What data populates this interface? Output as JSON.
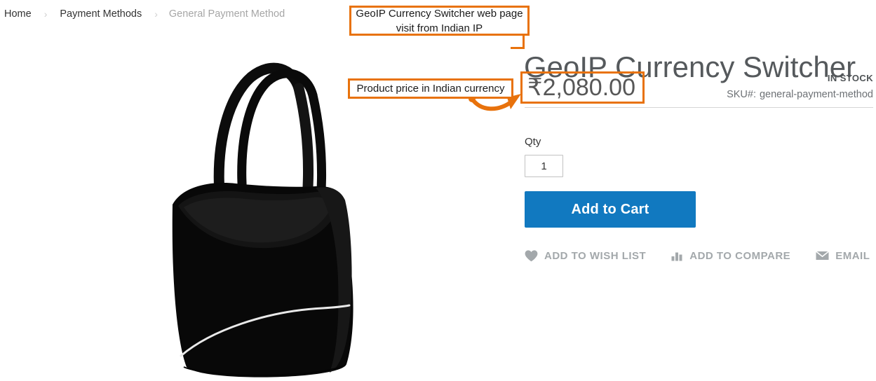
{
  "breadcrumb": {
    "separator": "›",
    "items": [
      {
        "label": "Home",
        "current": false
      },
      {
        "label": "Payment Methods",
        "current": false
      },
      {
        "label": "General Payment Method",
        "current": true
      }
    ]
  },
  "product": {
    "title": "GeoIP Currency Switcher",
    "price": "₹2,080.00",
    "price_currency_symbol": "₹",
    "price_amount": "2,080.00",
    "stock_status": "IN STOCK",
    "sku_label": "SKU#:",
    "sku_value": "general-payment-method",
    "image_alt": "black-tote-bag"
  },
  "purchase": {
    "qty_label": "Qty",
    "qty_value": "1",
    "qty_placeholder": "1",
    "add_to_cart_label": "Add to Cart"
  },
  "actions": [
    {
      "label": "ADD TO WISH LIST",
      "icon": "heart-icon"
    },
    {
      "label": "ADD TO COMPARE",
      "icon": "compare-bars-icon"
    },
    {
      "label": "EMAIL",
      "icon": "envelope-icon"
    }
  ],
  "annotations": [
    {
      "id": "page-visit",
      "line1": "GeoIP Currency Switcher web page",
      "line2": "visit from Indian IP"
    },
    {
      "id": "price-currency",
      "text": "Product price in Indian currency"
    }
  ],
  "colors": {
    "annotation_orange": "#E8720C",
    "add_to_cart_blue": "#1179C0",
    "title_gray": "#55595C",
    "price_gray": "#575757",
    "muted_gray": "#A3A8AB",
    "divider_gray": "#D6D6D6"
  }
}
